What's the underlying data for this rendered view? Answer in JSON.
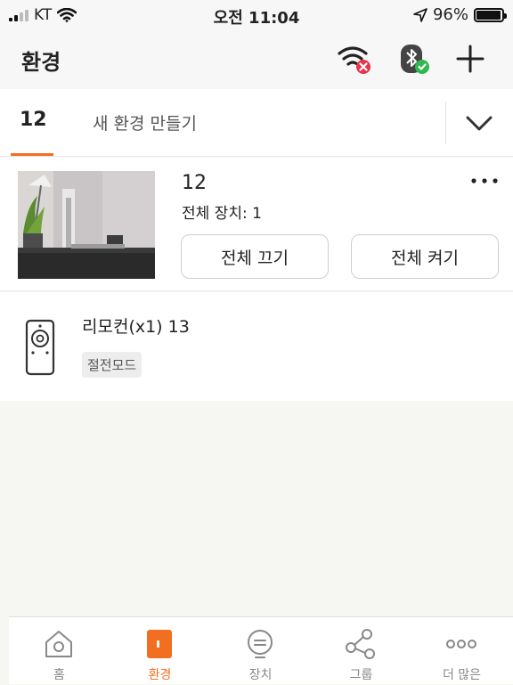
{
  "status_bar": {
    "carrier": "KT",
    "time": "오전 11:04",
    "battery_percent": "96%",
    "battery_level": 0.96
  },
  "header": {
    "title": "환경",
    "icons": [
      "wifi-disconnected-icon",
      "bluetooth-connected-icon",
      "add-icon"
    ]
  },
  "env_tabs": {
    "active": "12",
    "new_env": "새 환경 만들기"
  },
  "env_card": {
    "name": "12",
    "device_count": "전체 장치: 1",
    "off_all": "전체 끄기",
    "on_all": "전체 켜기"
  },
  "device": {
    "name": "리모컨(x1) 13",
    "badge": "절전모드",
    "icon": "remote-control-icon"
  },
  "tabbar": {
    "items": [
      {
        "label": "홈",
        "icon": "home-icon"
      },
      {
        "label": "환경",
        "icon": "environment-icon"
      },
      {
        "label": "장치",
        "icon": "device-icon"
      },
      {
        "label": "그룹",
        "icon": "group-icon"
      },
      {
        "label": "더 많은",
        "icon": "more-icon"
      }
    ],
    "active_index": 1
  },
  "colors": {
    "accent": "#f26f21",
    "wifi_error": "#e8344a",
    "bt_ok": "#2eb84f"
  }
}
